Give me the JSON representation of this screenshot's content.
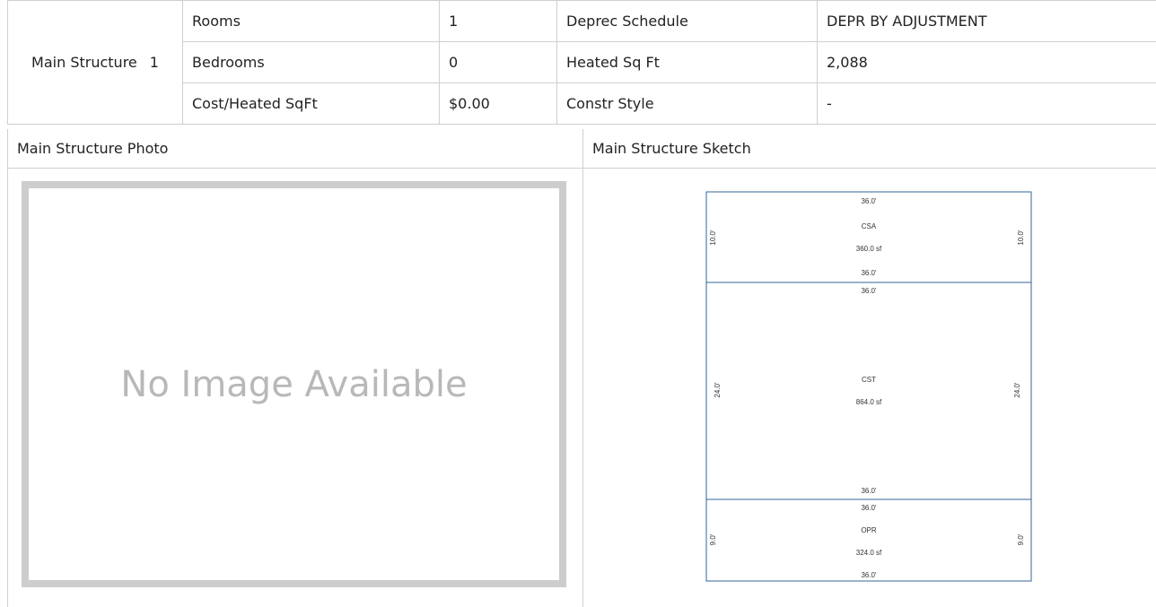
{
  "structure": {
    "label": "Main Structure",
    "number": "1",
    "rows": [
      {
        "k1": "Rooms",
        "v1": "1",
        "k2": "Deprec Schedule",
        "v2": "DEPR BY ADJUSTMENT"
      },
      {
        "k1": "Bedrooms",
        "v1": "0",
        "k2": "Heated Sq Ft",
        "v2": "2,088"
      },
      {
        "k1": "Cost/Heated SqFt",
        "v1": "$0.00",
        "k2": "Constr Style",
        "v2": "-"
      }
    ]
  },
  "photo": {
    "header": "Main Structure Photo",
    "placeholder": "No Image Available"
  },
  "sketch": {
    "header": "Main Structure Sketch",
    "line_color": "#336699",
    "areas": [
      {
        "code": "CSA",
        "area": "360.0 sf",
        "top": "36.0'",
        "bottom": "36.0'",
        "left": "10.0'",
        "right": "10.0'"
      },
      {
        "code": "CST",
        "area": "864.0 sf",
        "top": "36.0'",
        "bottom": "36.0'",
        "left": "24.0'",
        "right": "24.0'"
      },
      {
        "code": "OPR",
        "area": "324.0 sf",
        "top": "36.0'",
        "bottom": "36.0'",
        "left": "9.0'",
        "right": "9.0'"
      }
    ]
  }
}
